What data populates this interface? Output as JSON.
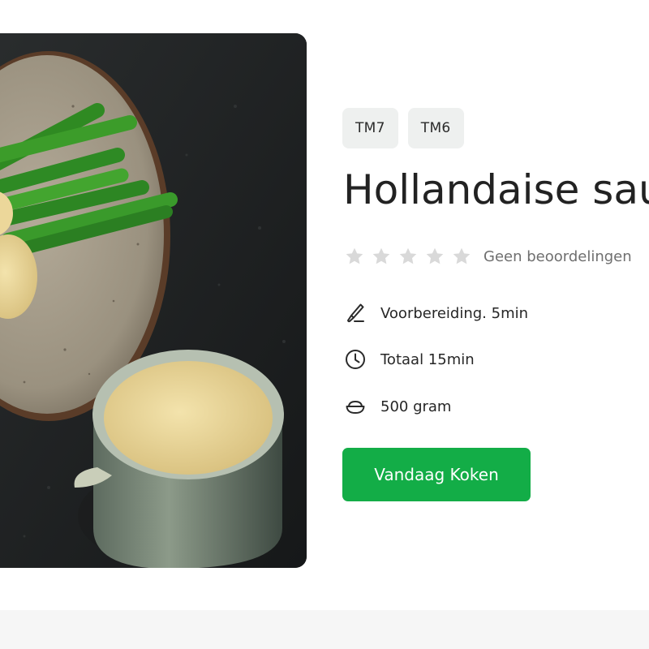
{
  "recipe": {
    "image_alt": "Hollandaise saus met groene asperges",
    "badges": [
      "TM7",
      "TM6"
    ],
    "title": "Hollandaise saus",
    "rating": {
      "stars_filled": 0,
      "stars_total": 5,
      "text": "Geen beoordelingen"
    },
    "prep_time": "Voorbereiding. 5min",
    "total_time": "Totaal 15min",
    "yield": "500 gram",
    "cook_button_label": "Vandaag Koken"
  },
  "colors": {
    "accent_green": "#13ad47",
    "badge_bg": "#eef0ef",
    "star_empty": "#d9d9d9"
  },
  "icons": {
    "prep": "knife-icon",
    "total": "clock-icon",
    "yield": "bowl-icon",
    "rating": "star-icon"
  }
}
